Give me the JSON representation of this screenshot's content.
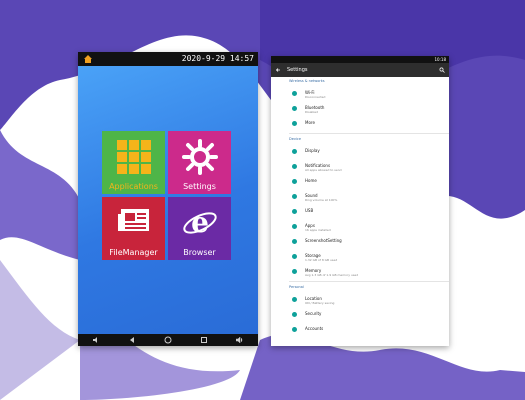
{
  "left_device": {
    "status_time": "2020-9-29 14:57",
    "tiles": [
      {
        "label": "Applications",
        "color": "#4eb548"
      },
      {
        "label": "Settings",
        "color": "#cc2a8b"
      },
      {
        "label": "FileManager",
        "color": "#c8243b"
      },
      {
        "label": "Browser",
        "color": "#6b2aa5"
      }
    ]
  },
  "right_device": {
    "status_time": "10:18",
    "toolbar_title": "Settings",
    "sections": [
      {
        "title": "Wireless & networks",
        "items": [
          {
            "title": "Wi-Fi",
            "subtitle": "Disconnected"
          },
          {
            "title": "Bluetooth",
            "subtitle": "Disabled"
          },
          {
            "title": "More",
            "subtitle": ""
          }
        ]
      },
      {
        "title": "Device",
        "items": [
          {
            "title": "Display",
            "subtitle": ""
          },
          {
            "title": "Notifications",
            "subtitle": "All apps allowed to send"
          },
          {
            "title": "Home",
            "subtitle": ""
          },
          {
            "title": "Sound",
            "subtitle": "Ring volume at 100%"
          },
          {
            "title": "USB",
            "subtitle": ""
          },
          {
            "title": "Apps",
            "subtitle": "16 apps installed"
          },
          {
            "title": "ScreenshotSetting",
            "subtitle": ""
          },
          {
            "title": "Storage",
            "subtitle": "1.32 GB of 8 GB used"
          },
          {
            "title": "Memory",
            "subtitle": "Avg 1.3 GB of 1.9 GB memory used"
          }
        ]
      },
      {
        "title": "Personal",
        "items": [
          {
            "title": "Location",
            "subtitle": "ON / Battery saving"
          },
          {
            "title": "Security",
            "subtitle": ""
          },
          {
            "title": "Accounts",
            "subtitle": ""
          }
        ]
      }
    ]
  }
}
